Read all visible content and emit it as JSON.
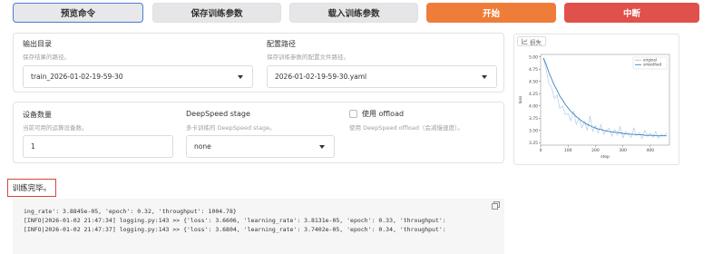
{
  "buttons": {
    "preview": "预览命令",
    "save": "保存训练参数",
    "load": "载入训练参数",
    "start": "开始",
    "stop": "中断"
  },
  "output_dir": {
    "label": "输出目录",
    "hint": "保存结果的路径。",
    "value": "train_2026-01-02-19-59-30"
  },
  "config_path": {
    "label": "配置路径",
    "hint": "保存训练参数的配置文件路径。",
    "value": "2026-01-02-19-59-30.yaml"
  },
  "device_count": {
    "label": "设备数量",
    "hint": "当前可用的运算设备数。",
    "value": "1"
  },
  "deepspeed": {
    "label": "DeepSpeed stage",
    "hint": "多卡训练的 DeepSpeed stage。",
    "value": "none"
  },
  "offload": {
    "label": "使用 offload",
    "hint": "使用 DeepSpeed offload（会减慢速度）。",
    "checked": false
  },
  "chart_tab": "损失",
  "status": "训练完毕。",
  "log_lines": [
    "ing_rate': 3.8845e-05, 'epoch': 0.32, 'throughput': 1004.78}",
    "[INFO|2026-01-02 21:47:34] logging.py:143 >> {'loss': 3.6606, 'learning_rate': 3.8131e-05, 'epoch': 0.33, 'throughput':",
    "[INFO|2026-01-02 21:47:37] logging.py:143 >> {'loss': 3.6804, 'learning_rate': 3.7402e-05, 'epoch': 0.34, 'throughput':"
  ],
  "chart_data": {
    "type": "line",
    "title": "",
    "xlabel": "step",
    "ylabel": "loss",
    "xlim": [
      0,
      470
    ],
    "ylim": [
      3.2,
      5.05
    ],
    "x_ticks": [
      0,
      100,
      200,
      300,
      400
    ],
    "y_ticks": [
      3.25,
      3.5,
      3.75,
      4.0,
      4.25,
      4.5,
      4.75,
      5.0
    ],
    "legend": "top-right",
    "series": [
      {
        "name": "original",
        "color": "#a9c4e0",
        "x": [
          10,
          20,
          30,
          40,
          50,
          60,
          70,
          80,
          90,
          100,
          110,
          120,
          130,
          140,
          150,
          160,
          170,
          180,
          190,
          200,
          210,
          220,
          230,
          240,
          250,
          260,
          270,
          280,
          290,
          300,
          310,
          320,
          330,
          340,
          350,
          360,
          370,
          380,
          390,
          400,
          410,
          420,
          430,
          440,
          450,
          460
        ],
        "y": [
          4.98,
          4.75,
          4.45,
          4.38,
          4.15,
          4.22,
          3.95,
          4.0,
          3.82,
          3.85,
          3.7,
          3.9,
          3.62,
          3.75,
          3.55,
          3.68,
          3.5,
          3.8,
          3.48,
          3.6,
          3.45,
          3.62,
          3.42,
          3.5,
          3.55,
          3.38,
          3.52,
          3.4,
          3.58,
          3.35,
          3.48,
          3.42,
          3.36,
          3.55,
          3.4,
          3.46,
          3.33,
          3.5,
          3.38,
          3.44,
          3.36,
          3.48,
          3.34,
          3.42,
          3.39,
          3.45
        ]
      },
      {
        "name": "smoothed",
        "color": "#3d7fc1",
        "x": [
          10,
          20,
          30,
          40,
          50,
          60,
          70,
          80,
          90,
          100,
          110,
          120,
          130,
          140,
          150,
          160,
          170,
          180,
          190,
          200,
          210,
          220,
          230,
          240,
          250,
          260,
          270,
          280,
          290,
          300,
          310,
          320,
          330,
          340,
          350,
          360,
          370,
          380,
          390,
          400,
          410,
          420,
          430,
          440,
          450,
          460
        ],
        "y": [
          4.98,
          4.85,
          4.68,
          4.55,
          4.42,
          4.32,
          4.2,
          4.12,
          4.03,
          3.96,
          3.89,
          3.84,
          3.78,
          3.74,
          3.69,
          3.66,
          3.62,
          3.6,
          3.57,
          3.55,
          3.53,
          3.52,
          3.5,
          3.49,
          3.48,
          3.47,
          3.46,
          3.46,
          3.45,
          3.44,
          3.43,
          3.43,
          3.42,
          3.42,
          3.41,
          3.41,
          3.41,
          3.4,
          3.4,
          3.4,
          3.4,
          3.39,
          3.39,
          3.39,
          3.39,
          3.39
        ]
      }
    ]
  }
}
